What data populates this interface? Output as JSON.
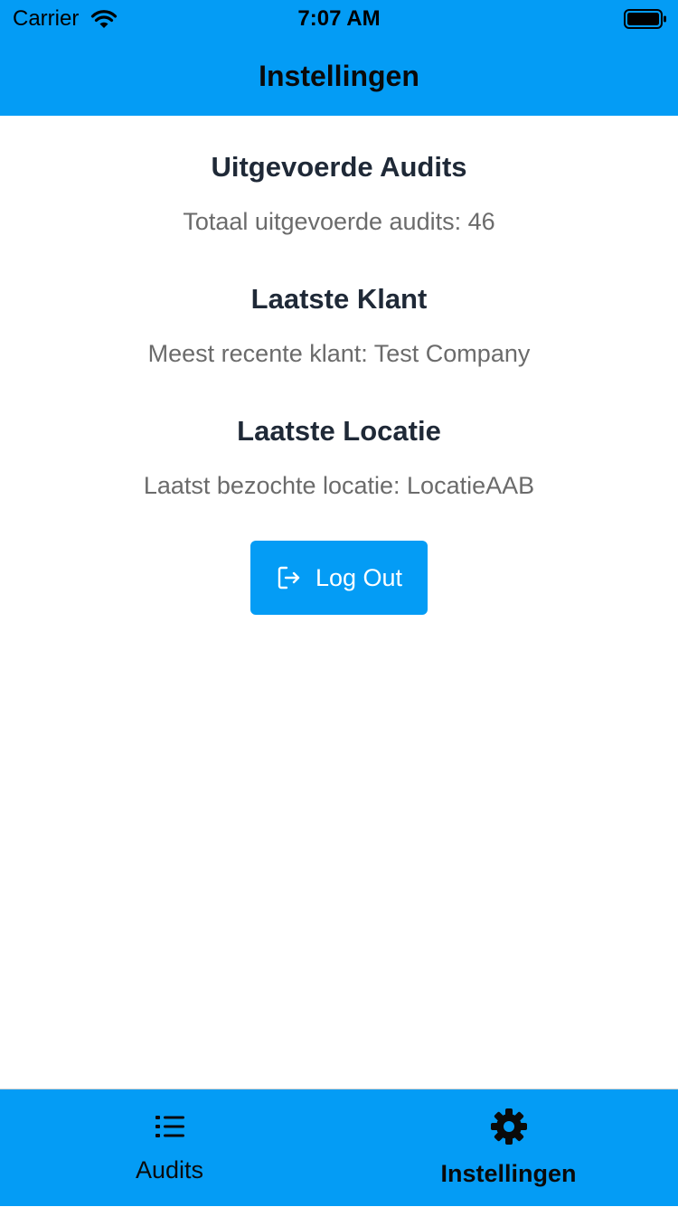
{
  "status_bar": {
    "carrier": "Carrier",
    "time": "7:07 AM"
  },
  "header": {
    "title": "Instellingen"
  },
  "sections": [
    {
      "title": "Uitgevoerde Audits",
      "text": "Totaal uitgevoerde audits: 46"
    },
    {
      "title": "Laatste Klant",
      "text": "Meest recente klant: Test Company"
    },
    {
      "title": "Laatste Locatie",
      "text": "Laatst bezochte locatie: LocatieAAB"
    }
  ],
  "logout_button": {
    "label": "Log Out",
    "icon": "logout-icon"
  },
  "tabbar": {
    "tabs": [
      {
        "label": "Audits",
        "icon": "list-icon",
        "active": false
      },
      {
        "label": "Instellingen",
        "icon": "gear-icon",
        "active": true
      }
    ]
  },
  "colors": {
    "primary": "#049cf5",
    "title_text": "#1f2937",
    "secondary_text": "#6b6b6b"
  }
}
